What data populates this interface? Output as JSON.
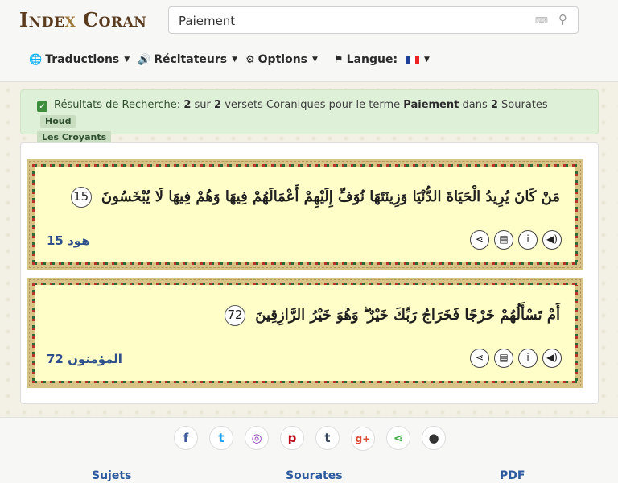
{
  "logo": "Index Coran",
  "search": {
    "value": "Paiement"
  },
  "nav": {
    "translations": "Traductions",
    "reciters": "Récitateurs",
    "options": "Options",
    "language": "Langue:"
  },
  "alert": {
    "link": "Résultats de Recherche",
    "sep": ":",
    "count": "2",
    "of": "sur",
    "total": "2",
    "text1": "versets Coraniques pour le terme",
    "term": "Paiement",
    "text2": "dans",
    "surah_count": "2",
    "text3": "Sourates",
    "tags": [
      "Houd",
      "Les Croyants"
    ]
  },
  "verses": [
    {
      "arabic": "مَنْ كَانَ يُرِيدُ الْحَيَاةَ الدُّنْيَا وَزِينَتَهَا نُوَفِّ إِلَيْهِمْ أَعْمَالَهُمْ فِيهَا وَهُمْ فِيهَا لَا يُبْخَسُونَ",
      "number": "15",
      "ref": "هود 15"
    },
    {
      "arabic": "أَمْ تَسْأَلُهُمْ خَرْجًا فَخَرَاجُ رَبِّكَ خَيْرٌ ۖ وَهُوَ خَيْرُ الرَّازِقِينَ",
      "number": "72",
      "ref": "المؤمنون 72"
    }
  ],
  "footer": {
    "links": [
      "Sujets",
      "Sourates",
      "PDF"
    ]
  },
  "colors": {
    "brand": "#5a3b1e",
    "link": "#2d5a9c",
    "verse_bg": "#fffdc8"
  }
}
